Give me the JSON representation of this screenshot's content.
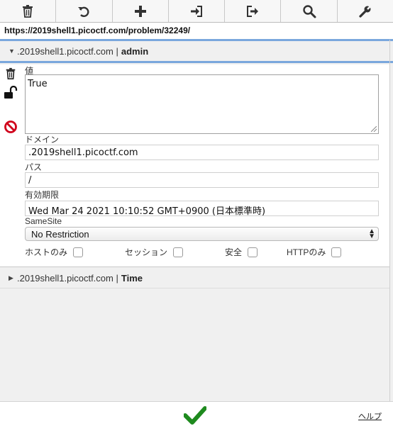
{
  "toolbar": {
    "buttons": [
      {
        "name": "delete-all",
        "icon": "trash-icon"
      },
      {
        "name": "reset",
        "icon": "undo-icon"
      },
      {
        "name": "add",
        "icon": "plus-icon"
      },
      {
        "name": "import",
        "icon": "import-icon"
      },
      {
        "name": "export",
        "icon": "export-icon"
      },
      {
        "name": "search",
        "icon": "search-icon"
      },
      {
        "name": "options",
        "icon": "wrench-icon"
      }
    ]
  },
  "url": "https://2019shell1.picoctf.com/problem/32249/",
  "cookies": [
    {
      "domain": ".2019shell1.picoctf.com",
      "separator": "|",
      "name": "admin",
      "expanded": true
    },
    {
      "domain": ".2019shell1.picoctf.com",
      "separator": "|",
      "name": "Time",
      "expanded": false
    }
  ],
  "editor": {
    "value_label": "値",
    "value": "True",
    "domain_label": "ドメイン",
    "domain": ".2019shell1.picoctf.com",
    "path_label": "パス",
    "path": "/",
    "expires_label": "有効期限",
    "expires": "Wed Mar 24 2021 10:10:52 GMT+0900 (日本標準時)",
    "samesite_label": "SameSite",
    "samesite": "No Restriction",
    "flags": {
      "host_only": "ホストのみ",
      "session": "セッション",
      "secure": "安全",
      "http_only": "HTTPのみ"
    }
  },
  "footer": {
    "help": "ヘルプ"
  },
  "colors": {
    "accent_line": "#7aa7dd",
    "delete_red": "#d0021b",
    "confirm_green": "#1e8a1e"
  }
}
